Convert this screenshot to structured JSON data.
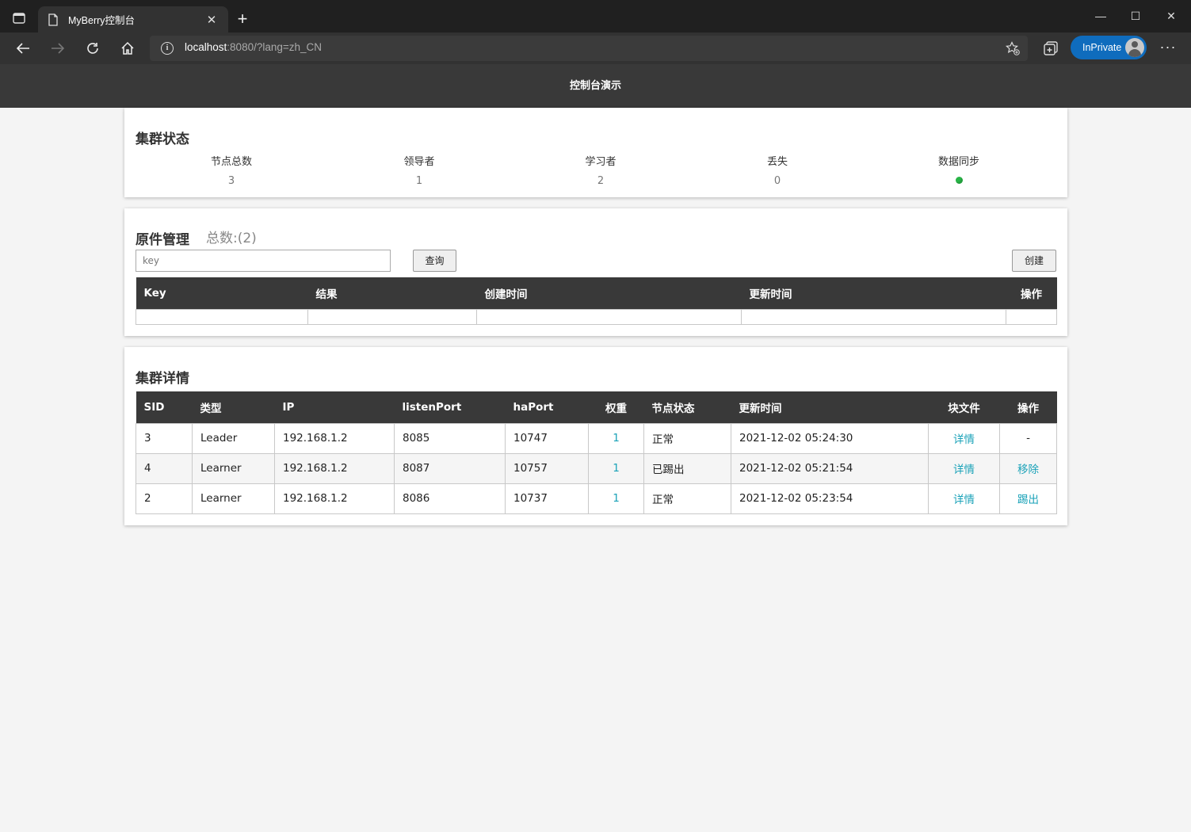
{
  "browser": {
    "tab_title": "MyBerry控制台",
    "url_host": "localhost",
    "url_rest": ":8080/?lang=zh_CN",
    "inprivate_label": "InPrivate",
    "close_glyph": "✕",
    "new_tab_glyph": "+",
    "more_glyph": "···",
    "minimize_glyph": "—",
    "maximize_glyph": "☐",
    "window_close_glyph": "✕",
    "info_glyph": "i"
  },
  "header": {
    "title": "控制台演示"
  },
  "cluster_status": {
    "title": "集群状态",
    "stats": [
      {
        "label": "节点总数",
        "value": "3"
      },
      {
        "label": "领导者",
        "value": "1"
      },
      {
        "label": "学习者",
        "value": "2"
      },
      {
        "label": "丢失",
        "value": "0"
      },
      {
        "label": "数据同步",
        "status_color": "#28b446"
      }
    ]
  },
  "primitive_mgmt": {
    "title": "原件管理",
    "count": "总数:(2)",
    "search_placeholder": "key",
    "query_button": "查询",
    "create_button": "创建",
    "columns": [
      "Key",
      "结果",
      "创建时间",
      "更新时间",
      "操作"
    ]
  },
  "cluster_detail": {
    "title": "集群详情",
    "columns": [
      "SID",
      "类型",
      "IP",
      "listenPort",
      "haPort",
      "权重",
      "节点状态",
      "更新时间",
      "块文件",
      "操作"
    ],
    "rows": [
      {
        "sid": "3",
        "type": "Leader",
        "ip": "192.168.1.2",
        "listenPort": "8085",
        "haPort": "10747",
        "weight": "1",
        "status": "正常",
        "updated": "2021-12-02 05:24:30",
        "file": "详情",
        "action": "-"
      },
      {
        "sid": "4",
        "type": "Learner",
        "ip": "192.168.1.2",
        "listenPort": "8087",
        "haPort": "10757",
        "weight": "1",
        "status": "已踢出",
        "updated": "2021-12-02 05:21:54",
        "file": "详情",
        "action": "移除"
      },
      {
        "sid": "2",
        "type": "Learner",
        "ip": "192.168.1.2",
        "listenPort": "8086",
        "haPort": "10737",
        "weight": "1",
        "status": "正常",
        "updated": "2021-12-02 05:23:54",
        "file": "详情",
        "action": "踢出"
      }
    ]
  }
}
